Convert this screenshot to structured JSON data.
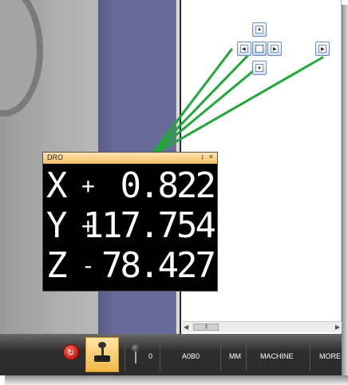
{
  "dro": {
    "title": "DRO",
    "pin_glyph": "↕",
    "close_glyph": "×",
    "axes": [
      {
        "axis": "X",
        "sign": "+",
        "value": "0.822"
      },
      {
        "axis": "Y",
        "sign": "+",
        "value": "117.754"
      },
      {
        "axis": "Z",
        "sign": "-",
        "value": "78.427"
      }
    ]
  },
  "toolbar": {
    "probe_count": "0",
    "position_label": "A0B0",
    "units_label": "MM",
    "coordinate_label": "MACHINE",
    "more_label": "MORE"
  },
  "scrollbar": {
    "thumb_grip": "|||"
  },
  "colors": {
    "viewport": "#686a98",
    "dro_background": "#000000",
    "dro_titlebar": "#f8c06a",
    "guide_lines": "#22a83a",
    "toolbar": "#2b2b2b"
  }
}
